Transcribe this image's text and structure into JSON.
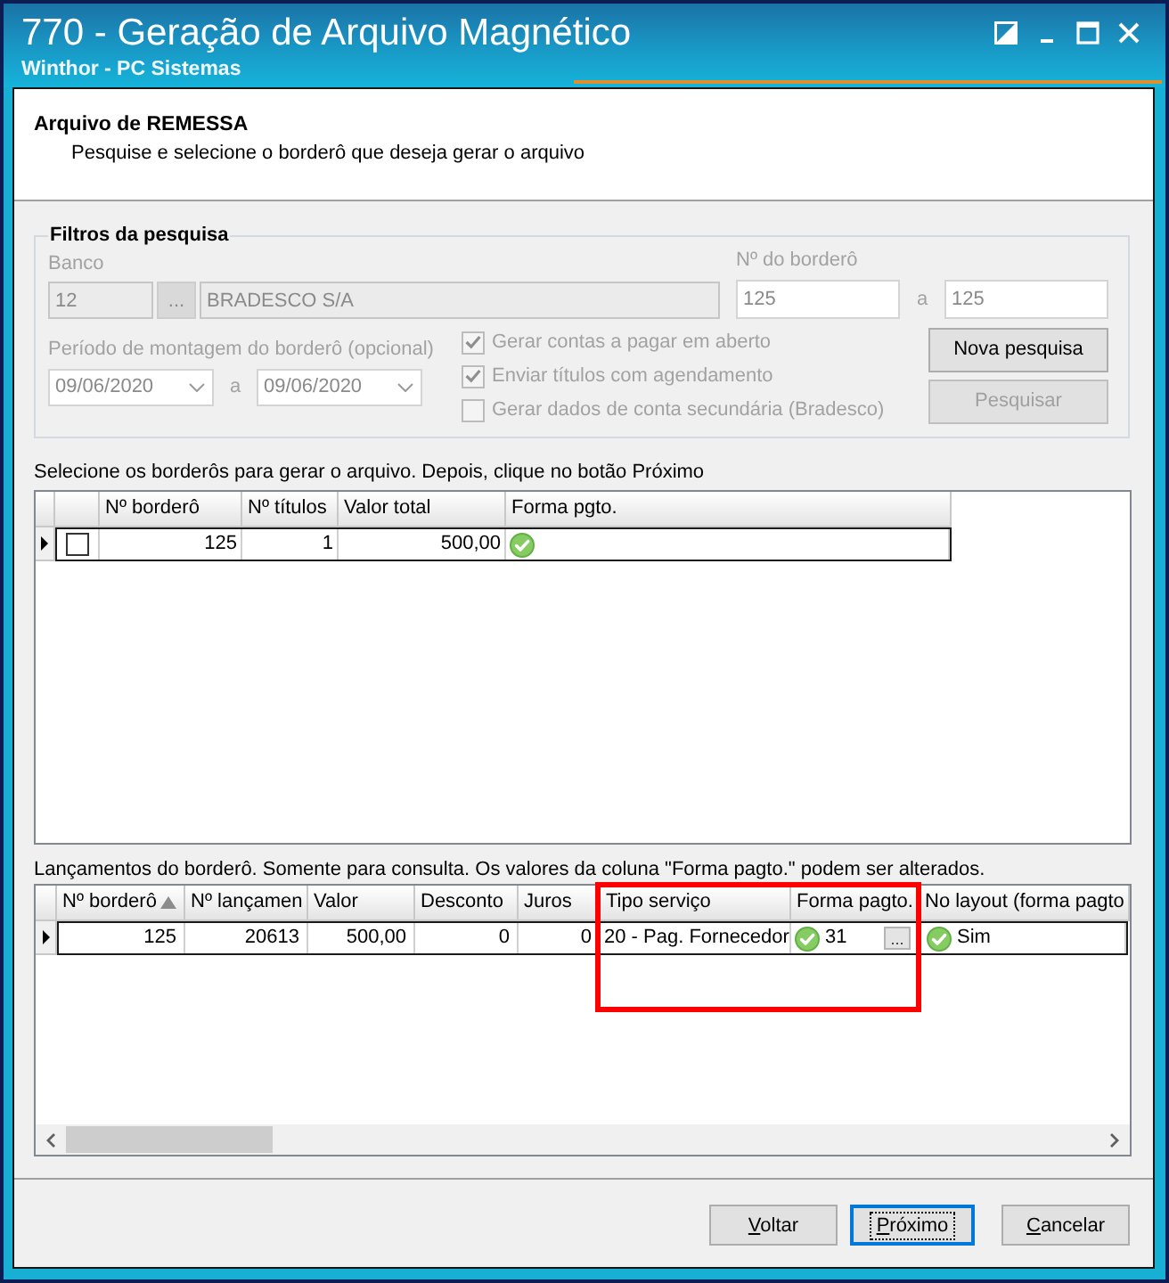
{
  "window": {
    "title": "770 - Geração de Arquivo Magnético",
    "subtitle": "Winthor - PC Sistemas"
  },
  "header": {
    "title": "Arquivo de REMESSA",
    "description": "Pesquise e selecione o borderô que deseja gerar o arquivo"
  },
  "filters": {
    "title": "Filtros da pesquisa",
    "disabled": true,
    "banco": {
      "label": "Banco",
      "code": {
        "value": "12",
        "read_only": true
      },
      "lookup_button": "...",
      "name": {
        "value": "BRADESCO S/A",
        "read_only": true
      }
    },
    "bordero": {
      "label": "Nº do borderô",
      "from": {
        "value": "125",
        "read_only": false
      },
      "separator": "a",
      "to": {
        "value": "125",
        "read_only": false
      }
    },
    "periodo": {
      "label": "Período de montagem do borderô (opcional)",
      "from": "09/06/2020",
      "separator": "a",
      "to": "09/06/2020"
    },
    "options": [
      {
        "label": "Gerar contas a pagar em aberto",
        "checked": true
      },
      {
        "label": "Enviar títulos com agendamento",
        "checked": true
      },
      {
        "label": "Gerar dados de conta secundária (Bradesco)",
        "checked": false
      }
    ],
    "buttons": [
      {
        "label": "Nova pesquisa",
        "disabled": false
      },
      {
        "label": "Pesquisar",
        "disabled": true
      }
    ]
  },
  "borderos": {
    "instruction": "Selecione os borderôs para gerar o arquivo. Depois, clique no botão Próximo",
    "columns": [
      "Nº borderô",
      "Nº títulos",
      "Valor total",
      "Forma pgto."
    ],
    "rows": [
      {
        "selected": true,
        "cells": [
          {
            "kind": "checkbox",
            "checked": false
          },
          {
            "kind": "number",
            "value": "125"
          },
          {
            "kind": "number",
            "value": "1"
          },
          {
            "kind": "number",
            "value": "500,00"
          },
          {
            "kind": "status",
            "ok": true
          }
        ]
      }
    ]
  },
  "lancamentos": {
    "instruction": "Lançamentos do borderô. Somente para consulta. Os valores da coluna \"Forma pagto.\" podem ser alterados.",
    "columns": [
      {
        "label": "Nº borderô",
        "sorted": true,
        "highlighted": false
      },
      {
        "label": "Nº lançamen",
        "sorted": false,
        "highlighted": false
      },
      {
        "label": "Valor",
        "sorted": false,
        "highlighted": false
      },
      {
        "label": "Desconto",
        "sorted": false,
        "highlighted": false
      },
      {
        "label": "Juros",
        "sorted": false,
        "highlighted": false
      },
      {
        "label": "Tipo serviço",
        "sorted": false,
        "highlighted": true
      },
      {
        "label": "Forma pagto.",
        "sorted": false,
        "highlighted": true
      },
      {
        "label": "No layout (forma pagto",
        "sorted": false,
        "highlighted": false
      }
    ],
    "rows": [
      {
        "selected": true,
        "cells": [
          {
            "kind": "number",
            "value": "125"
          },
          {
            "kind": "number",
            "value": "20613"
          },
          {
            "kind": "number",
            "value": "500,00"
          },
          {
            "kind": "number",
            "value": "0"
          },
          {
            "kind": "number",
            "value": "0"
          },
          {
            "kind": "text",
            "value": "20 - Pag. Fornecedor"
          },
          {
            "kind": "lookup",
            "ok": true,
            "value": "31",
            "button": "..."
          },
          {
            "kind": "status",
            "ok": true,
            "value": "Sim"
          }
        ]
      }
    ]
  },
  "footer_buttons": [
    {
      "label": "Voltar",
      "default": false
    },
    {
      "label": "Próximo",
      "default": true
    },
    {
      "label": "Cancelar",
      "default": false
    }
  ]
}
